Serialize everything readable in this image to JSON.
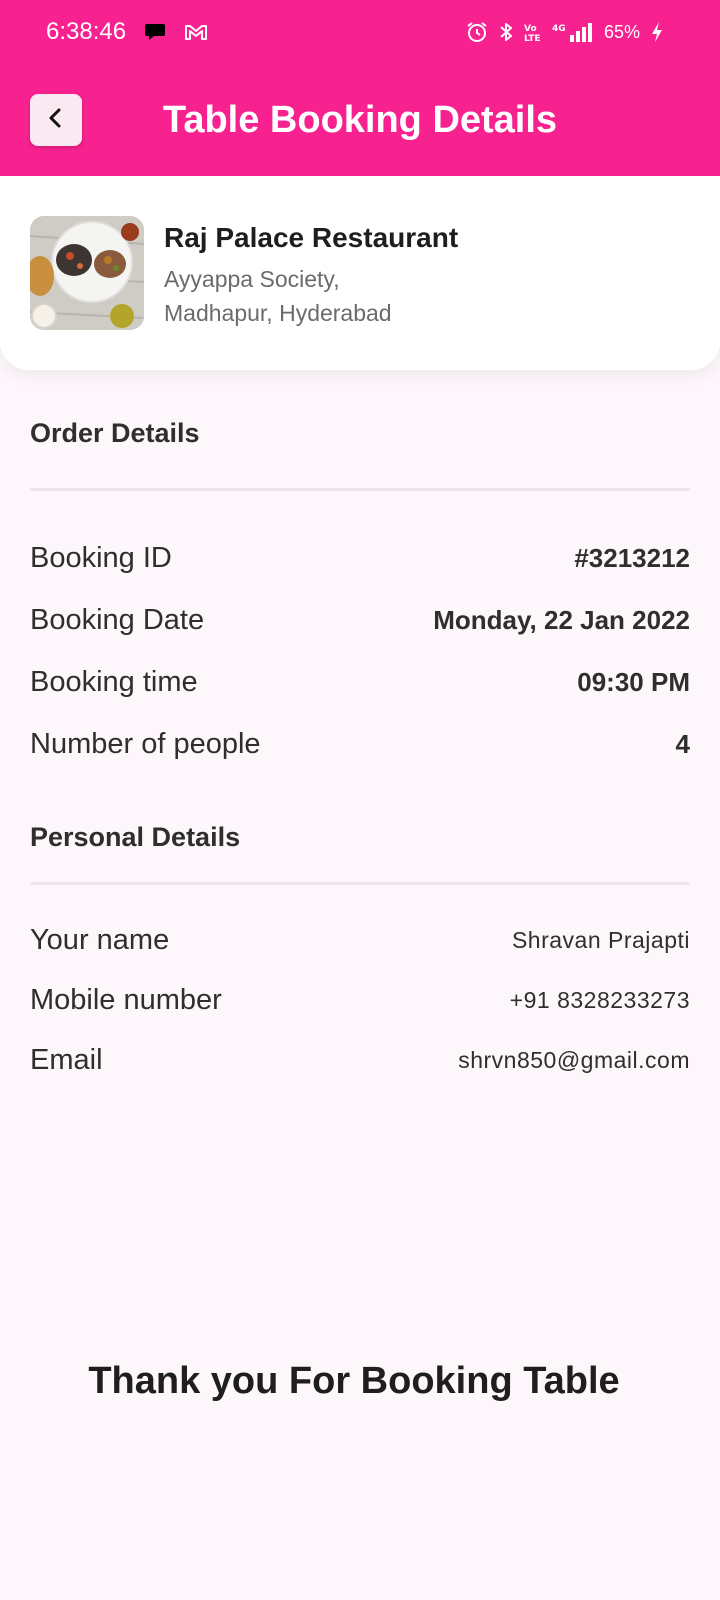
{
  "status_bar": {
    "time": "6:38:46",
    "battery": "65%",
    "network": "4G",
    "left_icons": [
      "chat-bubble-icon",
      "gmail-icon"
    ],
    "right_icons": [
      "alarm-icon",
      "bluetooth-icon",
      "volte-icon",
      "signal-icon",
      "battery-charging-icon"
    ]
  },
  "colors": {
    "primary": "#f72190",
    "background": "#fdf7fb",
    "back_button_bg": "#fbe9f2"
  },
  "app_bar": {
    "title": "Table Booking Details",
    "back_icon": "chevron-left-icon"
  },
  "restaurant": {
    "name": "Raj Palace Restaurant",
    "address_line1": "Ayyappa Society,",
    "address_line2": "Madhapur, Hyderabad"
  },
  "order_details": {
    "title": "Order Details",
    "rows": [
      {
        "label": "Booking ID",
        "value": "#3213212"
      },
      {
        "label": "Booking Date",
        "value": "Monday, 22 Jan 2022"
      },
      {
        "label": "Booking time",
        "value": "09:30 PM"
      },
      {
        "label": "Number of people",
        "value": "4"
      }
    ]
  },
  "personal_details": {
    "title": "Personal Details",
    "rows": [
      {
        "label": "Your name",
        "value": "Shravan Prajapti"
      },
      {
        "label": "Mobile number",
        "value": "+91 8328233273"
      },
      {
        "label": "Email",
        "value": "shrvn850@gmail.com"
      }
    ]
  },
  "footer": {
    "thank_you": "Thank you For Booking Table"
  }
}
